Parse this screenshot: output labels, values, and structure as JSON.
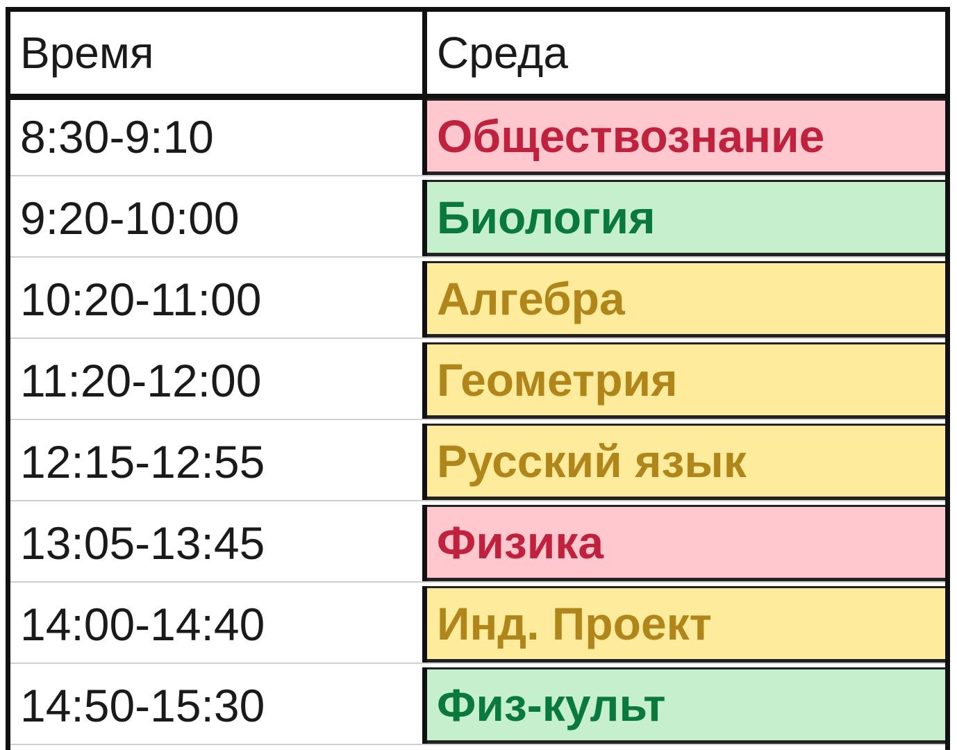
{
  "table": {
    "header": {
      "time_label": "Время",
      "day_label": "Среда"
    },
    "rows": [
      {
        "time": "8:30-9:10",
        "subject": "Обществознание",
        "style": "red"
      },
      {
        "time": "9:20-10:00",
        "subject": "Биология",
        "style": "green"
      },
      {
        "time": "10:20-11:00",
        "subject": "Алгебра",
        "style": "yellow"
      },
      {
        "time": "11:20-12:00",
        "subject": "Геометрия",
        "style": "yellow"
      },
      {
        "time": "12:15-12:55",
        "subject": "Русский язык",
        "style": "yellow"
      },
      {
        "time": "13:05-13:45",
        "subject": "Физика",
        "style": "red"
      },
      {
        "time": "14:00-14:40",
        "subject": "Инд. Проект",
        "style": "yellow"
      },
      {
        "time": "14:50-15:30",
        "subject": "Физ-культ",
        "style": "green"
      }
    ]
  },
  "colors": {
    "red_fill": "#ffc7ce",
    "red_text": "#c0223d",
    "green_fill": "#c6efce",
    "green_text": "#0a7a3c",
    "yellow_fill": "#ffeb9c",
    "yellow_text": "#b0851a"
  }
}
